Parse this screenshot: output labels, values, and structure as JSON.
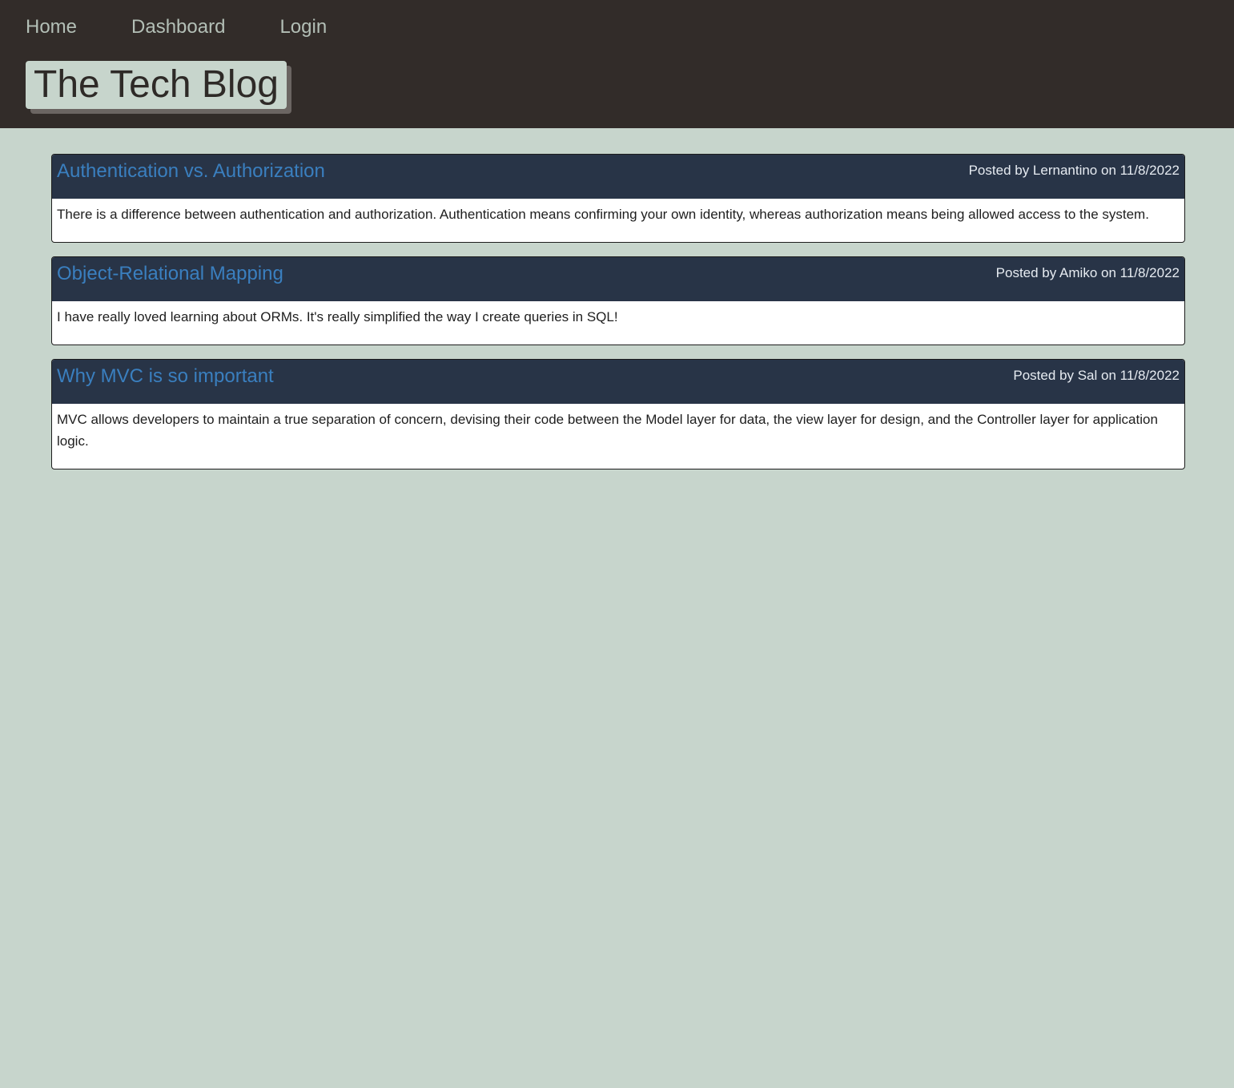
{
  "nav": {
    "items": [
      {
        "label": "Home"
      },
      {
        "label": "Dashboard"
      },
      {
        "label": "Login"
      }
    ]
  },
  "brand": {
    "title": "The Tech Blog"
  },
  "posts": [
    {
      "title": "Authentication vs. Authorization",
      "meta": "Posted by Lernantino on 11/8/2022",
      "body": "There is a difference between authentication and authorization. Authentication means confirming your own identity, whereas authorization means being allowed access to the system."
    },
    {
      "title": "Object-Relational Mapping",
      "meta": "Posted by Amiko on 11/8/2022",
      "body": "I have really loved learning about ORMs. It's really simplified the way I create queries in SQL!"
    },
    {
      "title": "Why MVC is so important",
      "meta": "Posted by Sal on 11/8/2022",
      "body": "MVC allows developers to maintain a true separation of concern, devising their code between the Model layer for data, the view layer for design, and the Controller layer for application logic."
    }
  ],
  "colors": {
    "header_bg": "#322c29",
    "page_bg": "#c7d5cc",
    "post_header_bg": "#283447",
    "post_title": "#3a7fbf"
  }
}
